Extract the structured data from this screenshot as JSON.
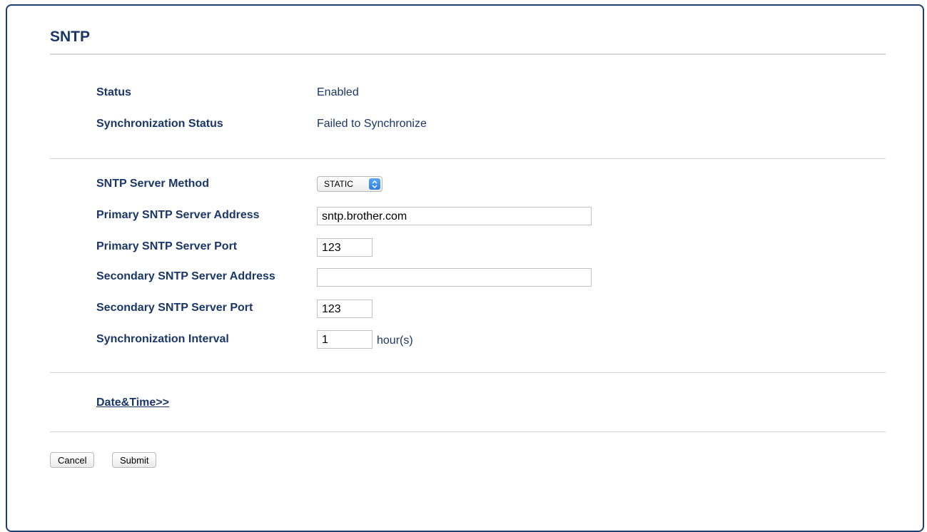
{
  "page": {
    "title": "SNTP"
  },
  "status_section": {
    "status_label": "Status",
    "status_value": "Enabled",
    "sync_status_label": "Synchronization Status",
    "sync_status_value": "Failed to Synchronize"
  },
  "settings": {
    "server_method_label": "SNTP Server Method",
    "server_method_value": "STATIC",
    "primary_address_label": "Primary SNTP Server Address",
    "primary_address_value": "sntp.brother.com",
    "primary_port_label": "Primary SNTP Server Port",
    "primary_port_value": "123",
    "secondary_address_label": "Secondary SNTP Server Address",
    "secondary_address_value": "",
    "secondary_port_label": "Secondary SNTP Server Port",
    "secondary_port_value": "123",
    "sync_interval_label": "Synchronization Interval",
    "sync_interval_value": "1",
    "sync_interval_unit": "hour(s)"
  },
  "links": {
    "date_time": "Date&Time>>"
  },
  "buttons": {
    "cancel": "Cancel",
    "submit": "Submit"
  },
  "icons": {
    "select_arrow": "up-down-chevron-icon"
  },
  "colors": {
    "heading": "#1a3768",
    "frame_border": "#1f3f6e",
    "select_accent": "#3b8ce8"
  }
}
